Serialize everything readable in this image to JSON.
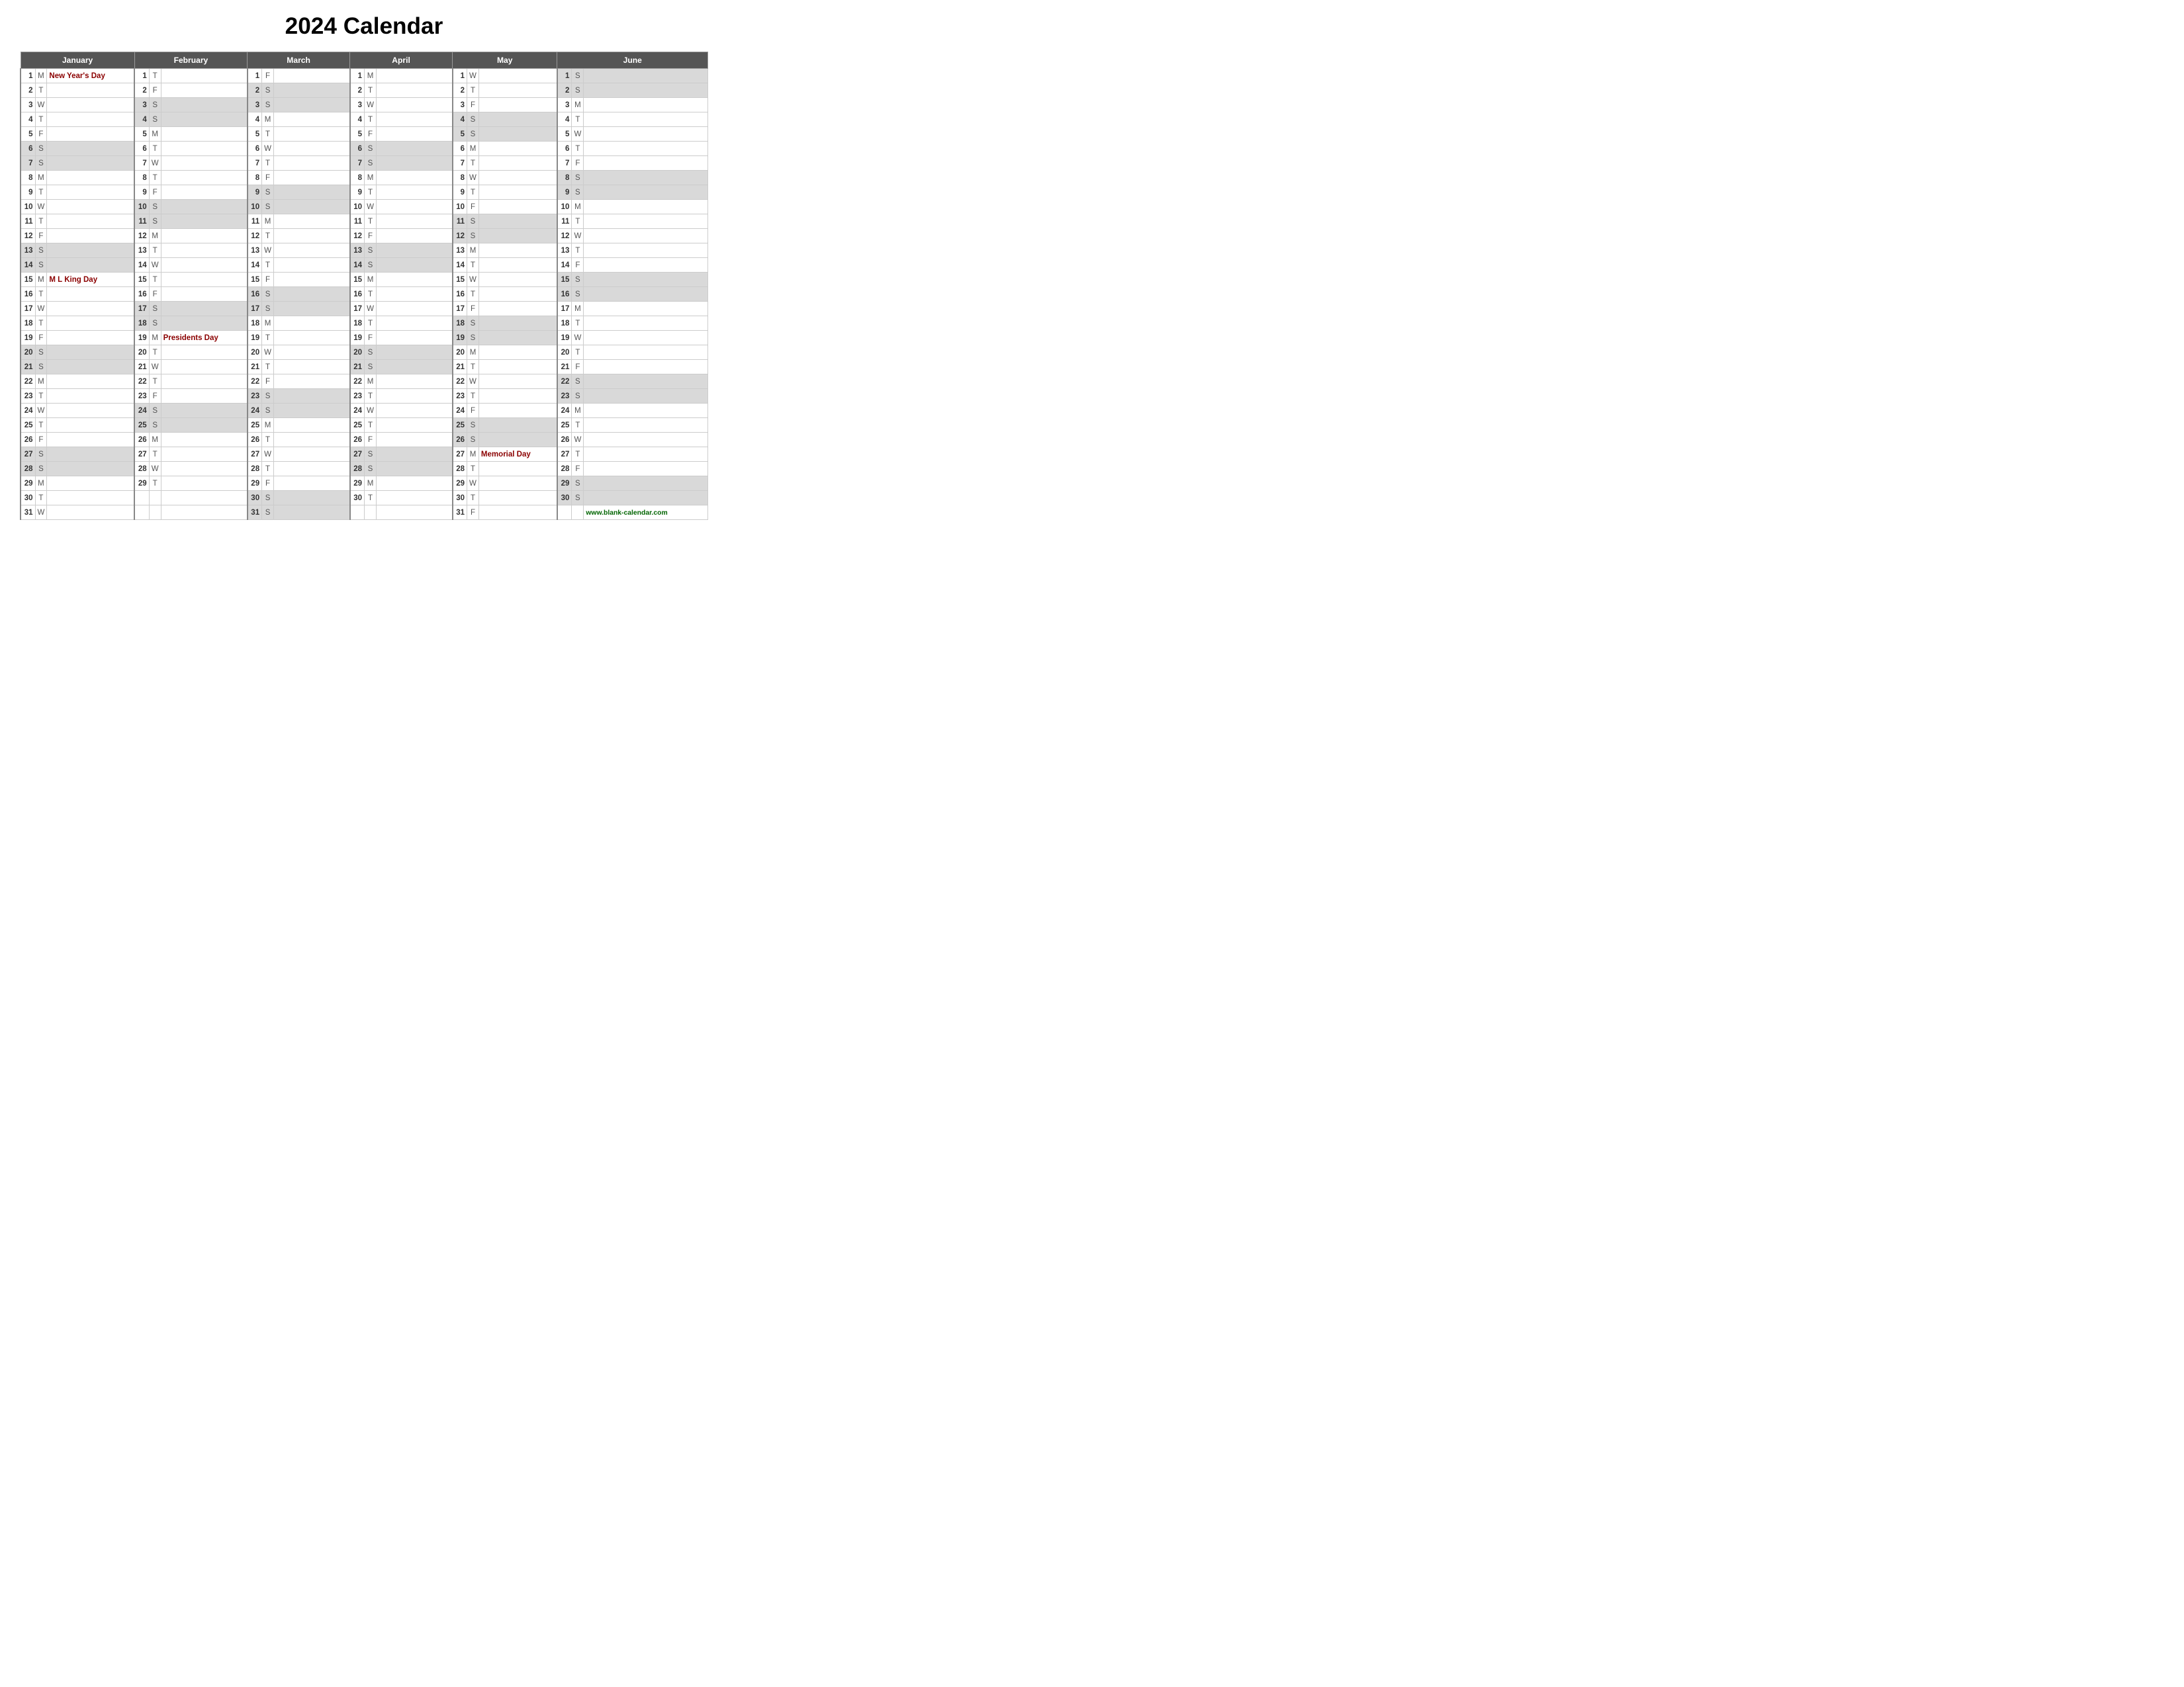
{
  "title": "2024 Calendar",
  "months": [
    "January",
    "February",
    "March",
    "April",
    "May",
    "June"
  ],
  "website": "www.blank-calendar.com",
  "holidays": {
    "jan_1": "New Year's Day",
    "jan_15": "M L King Day",
    "feb_19": "Presidents Day",
    "may_27": "Memorial Day"
  },
  "rows": [
    {
      "jan": {
        "d": 1,
        "l": "M",
        "h": "New Year's Day"
      },
      "feb": {
        "d": 1,
        "l": "T",
        "h": ""
      },
      "mar": {
        "d": 1,
        "l": "F",
        "h": ""
      },
      "apr": {
        "d": 1,
        "l": "M",
        "h": ""
      },
      "may": {
        "d": 1,
        "l": "W",
        "h": ""
      },
      "jun": {
        "d": 1,
        "l": "S",
        "h": "",
        "shade": true
      }
    },
    {
      "jan": {
        "d": 2,
        "l": "T",
        "h": ""
      },
      "feb": {
        "d": 2,
        "l": "F",
        "h": ""
      },
      "mar": {
        "d": 2,
        "l": "S",
        "h": "",
        "shade": true
      },
      "apr": {
        "d": 2,
        "l": "T",
        "h": ""
      },
      "may": {
        "d": 2,
        "l": "T",
        "h": ""
      },
      "jun": {
        "d": 2,
        "l": "S",
        "h": "",
        "shade": true
      }
    },
    {
      "jan": {
        "d": 3,
        "l": "W",
        "h": ""
      },
      "feb": {
        "d": 3,
        "l": "S",
        "h": "",
        "shade": true
      },
      "mar": {
        "d": 3,
        "l": "S",
        "h": "",
        "shade": true
      },
      "apr": {
        "d": 3,
        "l": "W",
        "h": ""
      },
      "may": {
        "d": 3,
        "l": "F",
        "h": ""
      },
      "jun": {
        "d": 3,
        "l": "M",
        "h": ""
      }
    },
    {
      "jan": {
        "d": 4,
        "l": "T",
        "h": ""
      },
      "feb": {
        "d": 4,
        "l": "S",
        "h": "",
        "shade": true
      },
      "mar": {
        "d": 4,
        "l": "M",
        "h": ""
      },
      "apr": {
        "d": 4,
        "l": "T",
        "h": ""
      },
      "may": {
        "d": 4,
        "l": "S",
        "h": "",
        "shade": true
      },
      "jun": {
        "d": 4,
        "l": "T",
        "h": ""
      }
    },
    {
      "jan": {
        "d": 5,
        "l": "F",
        "h": ""
      },
      "feb": {
        "d": 5,
        "l": "M",
        "h": ""
      },
      "mar": {
        "d": 5,
        "l": "T",
        "h": ""
      },
      "apr": {
        "d": 5,
        "l": "F",
        "h": ""
      },
      "may": {
        "d": 5,
        "l": "S",
        "h": "",
        "shade": true
      },
      "jun": {
        "d": 5,
        "l": "W",
        "h": ""
      }
    },
    {
      "jan": {
        "d": 6,
        "l": "S",
        "h": "",
        "shade": true
      },
      "feb": {
        "d": 6,
        "l": "T",
        "h": ""
      },
      "mar": {
        "d": 6,
        "l": "W",
        "h": ""
      },
      "apr": {
        "d": 6,
        "l": "S",
        "h": "",
        "shade": true
      },
      "may": {
        "d": 6,
        "l": "M",
        "h": ""
      },
      "jun": {
        "d": 6,
        "l": "T",
        "h": ""
      }
    },
    {
      "jan": {
        "d": 7,
        "l": "S",
        "h": "",
        "shade": true
      },
      "feb": {
        "d": 7,
        "l": "W",
        "h": ""
      },
      "mar": {
        "d": 7,
        "l": "T",
        "h": ""
      },
      "apr": {
        "d": 7,
        "l": "S",
        "h": "",
        "shade": true
      },
      "may": {
        "d": 7,
        "l": "T",
        "h": ""
      },
      "jun": {
        "d": 7,
        "l": "F",
        "h": ""
      }
    },
    {
      "jan": {
        "d": 8,
        "l": "M",
        "h": ""
      },
      "feb": {
        "d": 8,
        "l": "T",
        "h": ""
      },
      "mar": {
        "d": 8,
        "l": "F",
        "h": ""
      },
      "apr": {
        "d": 8,
        "l": "M",
        "h": ""
      },
      "may": {
        "d": 8,
        "l": "W",
        "h": ""
      },
      "jun": {
        "d": 8,
        "l": "S",
        "h": "",
        "shade": true
      }
    },
    {
      "jan": {
        "d": 9,
        "l": "T",
        "h": ""
      },
      "feb": {
        "d": 9,
        "l": "F",
        "h": ""
      },
      "mar": {
        "d": 9,
        "l": "S",
        "h": "",
        "shade": true
      },
      "apr": {
        "d": 9,
        "l": "T",
        "h": ""
      },
      "may": {
        "d": 9,
        "l": "T",
        "h": ""
      },
      "jun": {
        "d": 9,
        "l": "S",
        "h": "",
        "shade": true
      }
    },
    {
      "jan": {
        "d": 10,
        "l": "W",
        "h": ""
      },
      "feb": {
        "d": 10,
        "l": "S",
        "h": "",
        "shade": true
      },
      "mar": {
        "d": 10,
        "l": "S",
        "h": "",
        "shade": true
      },
      "apr": {
        "d": 10,
        "l": "W",
        "h": ""
      },
      "may": {
        "d": 10,
        "l": "F",
        "h": ""
      },
      "jun": {
        "d": 10,
        "l": "M",
        "h": ""
      }
    },
    {
      "jan": {
        "d": 11,
        "l": "T",
        "h": ""
      },
      "feb": {
        "d": 11,
        "l": "S",
        "h": "",
        "shade": true
      },
      "mar": {
        "d": 11,
        "l": "M",
        "h": ""
      },
      "apr": {
        "d": 11,
        "l": "T",
        "h": ""
      },
      "may": {
        "d": 11,
        "l": "S",
        "h": "",
        "shade": true
      },
      "jun": {
        "d": 11,
        "l": "T",
        "h": ""
      }
    },
    {
      "jan": {
        "d": 12,
        "l": "F",
        "h": ""
      },
      "feb": {
        "d": 12,
        "l": "M",
        "h": ""
      },
      "mar": {
        "d": 12,
        "l": "T",
        "h": ""
      },
      "apr": {
        "d": 12,
        "l": "F",
        "h": ""
      },
      "may": {
        "d": 12,
        "l": "S",
        "h": "",
        "shade": true
      },
      "jun": {
        "d": 12,
        "l": "W",
        "h": ""
      }
    },
    {
      "jan": {
        "d": 13,
        "l": "S",
        "h": "",
        "shade": true
      },
      "feb": {
        "d": 13,
        "l": "T",
        "h": ""
      },
      "mar": {
        "d": 13,
        "l": "W",
        "h": ""
      },
      "apr": {
        "d": 13,
        "l": "S",
        "h": "",
        "shade": true
      },
      "may": {
        "d": 13,
        "l": "M",
        "h": ""
      },
      "jun": {
        "d": 13,
        "l": "T",
        "h": ""
      }
    },
    {
      "jan": {
        "d": 14,
        "l": "S",
        "h": "",
        "shade": true
      },
      "feb": {
        "d": 14,
        "l": "W",
        "h": ""
      },
      "mar": {
        "d": 14,
        "l": "T",
        "h": ""
      },
      "apr": {
        "d": 14,
        "l": "S",
        "h": "",
        "shade": true
      },
      "may": {
        "d": 14,
        "l": "T",
        "h": ""
      },
      "jun": {
        "d": 14,
        "l": "F",
        "h": ""
      }
    },
    {
      "jan": {
        "d": 15,
        "l": "M",
        "h": "M L King Day"
      },
      "feb": {
        "d": 15,
        "l": "T",
        "h": ""
      },
      "mar": {
        "d": 15,
        "l": "F",
        "h": ""
      },
      "apr": {
        "d": 15,
        "l": "M",
        "h": ""
      },
      "may": {
        "d": 15,
        "l": "W",
        "h": ""
      },
      "jun": {
        "d": 15,
        "l": "S",
        "h": "",
        "shade": true
      }
    },
    {
      "jan": {
        "d": 16,
        "l": "T",
        "h": ""
      },
      "feb": {
        "d": 16,
        "l": "F",
        "h": ""
      },
      "mar": {
        "d": 16,
        "l": "S",
        "h": "",
        "shade": true
      },
      "apr": {
        "d": 16,
        "l": "T",
        "h": ""
      },
      "may": {
        "d": 16,
        "l": "T",
        "h": ""
      },
      "jun": {
        "d": 16,
        "l": "S",
        "h": "",
        "shade": true
      }
    },
    {
      "jan": {
        "d": 17,
        "l": "W",
        "h": ""
      },
      "feb": {
        "d": 17,
        "l": "S",
        "h": "",
        "shade": true
      },
      "mar": {
        "d": 17,
        "l": "S",
        "h": "",
        "shade": true
      },
      "apr": {
        "d": 17,
        "l": "W",
        "h": ""
      },
      "may": {
        "d": 17,
        "l": "F",
        "h": ""
      },
      "jun": {
        "d": 17,
        "l": "M",
        "h": ""
      }
    },
    {
      "jan": {
        "d": 18,
        "l": "T",
        "h": ""
      },
      "feb": {
        "d": 18,
        "l": "S",
        "h": "",
        "shade": true
      },
      "mar": {
        "d": 18,
        "l": "M",
        "h": ""
      },
      "apr": {
        "d": 18,
        "l": "T",
        "h": ""
      },
      "may": {
        "d": 18,
        "l": "S",
        "h": "",
        "shade": true
      },
      "jun": {
        "d": 18,
        "l": "T",
        "h": ""
      }
    },
    {
      "jan": {
        "d": 19,
        "l": "F",
        "h": ""
      },
      "feb": {
        "d": 19,
        "l": "M",
        "h": "Presidents Day"
      },
      "mar": {
        "d": 19,
        "l": "T",
        "h": ""
      },
      "apr": {
        "d": 19,
        "l": "F",
        "h": ""
      },
      "may": {
        "d": 19,
        "l": "S",
        "h": "",
        "shade": true
      },
      "jun": {
        "d": 19,
        "l": "W",
        "h": ""
      }
    },
    {
      "jan": {
        "d": 20,
        "l": "S",
        "h": "",
        "shade": true
      },
      "feb": {
        "d": 20,
        "l": "T",
        "h": ""
      },
      "mar": {
        "d": 20,
        "l": "W",
        "h": ""
      },
      "apr": {
        "d": 20,
        "l": "S",
        "h": "",
        "shade": true
      },
      "may": {
        "d": 20,
        "l": "M",
        "h": ""
      },
      "jun": {
        "d": 20,
        "l": "T",
        "h": ""
      }
    },
    {
      "jan": {
        "d": 21,
        "l": "S",
        "h": "",
        "shade": true
      },
      "feb": {
        "d": 21,
        "l": "W",
        "h": ""
      },
      "mar": {
        "d": 21,
        "l": "T",
        "h": ""
      },
      "apr": {
        "d": 21,
        "l": "S",
        "h": "",
        "shade": true
      },
      "may": {
        "d": 21,
        "l": "T",
        "h": ""
      },
      "jun": {
        "d": 21,
        "l": "F",
        "h": ""
      }
    },
    {
      "jan": {
        "d": 22,
        "l": "M",
        "h": ""
      },
      "feb": {
        "d": 22,
        "l": "T",
        "h": ""
      },
      "mar": {
        "d": 22,
        "l": "F",
        "h": ""
      },
      "apr": {
        "d": 22,
        "l": "M",
        "h": ""
      },
      "may": {
        "d": 22,
        "l": "W",
        "h": ""
      },
      "jun": {
        "d": 22,
        "l": "S",
        "h": "",
        "shade": true
      }
    },
    {
      "jan": {
        "d": 23,
        "l": "T",
        "h": ""
      },
      "feb": {
        "d": 23,
        "l": "F",
        "h": ""
      },
      "mar": {
        "d": 23,
        "l": "S",
        "h": "",
        "shade": true
      },
      "apr": {
        "d": 23,
        "l": "T",
        "h": ""
      },
      "may": {
        "d": 23,
        "l": "T",
        "h": ""
      },
      "jun": {
        "d": 23,
        "l": "S",
        "h": "",
        "shade": true
      }
    },
    {
      "jan": {
        "d": 24,
        "l": "W",
        "h": ""
      },
      "feb": {
        "d": 24,
        "l": "S",
        "h": "",
        "shade": true
      },
      "mar": {
        "d": 24,
        "l": "S",
        "h": "",
        "shade": true
      },
      "apr": {
        "d": 24,
        "l": "W",
        "h": ""
      },
      "may": {
        "d": 24,
        "l": "F",
        "h": ""
      },
      "jun": {
        "d": 24,
        "l": "M",
        "h": ""
      }
    },
    {
      "jan": {
        "d": 25,
        "l": "T",
        "h": ""
      },
      "feb": {
        "d": 25,
        "l": "S",
        "h": "",
        "shade": true
      },
      "mar": {
        "d": 25,
        "l": "M",
        "h": ""
      },
      "apr": {
        "d": 25,
        "l": "T",
        "h": ""
      },
      "may": {
        "d": 25,
        "l": "S",
        "h": "",
        "shade": true
      },
      "jun": {
        "d": 25,
        "l": "T",
        "h": ""
      }
    },
    {
      "jan": {
        "d": 26,
        "l": "F",
        "h": ""
      },
      "feb": {
        "d": 26,
        "l": "M",
        "h": ""
      },
      "mar": {
        "d": 26,
        "l": "T",
        "h": ""
      },
      "apr": {
        "d": 26,
        "l": "F",
        "h": ""
      },
      "may": {
        "d": 26,
        "l": "S",
        "h": "",
        "shade": true
      },
      "jun": {
        "d": 26,
        "l": "W",
        "h": ""
      }
    },
    {
      "jan": {
        "d": 27,
        "l": "S",
        "h": "",
        "shade": true
      },
      "feb": {
        "d": 27,
        "l": "T",
        "h": ""
      },
      "mar": {
        "d": 27,
        "l": "W",
        "h": ""
      },
      "apr": {
        "d": 27,
        "l": "S",
        "h": "",
        "shade": true
      },
      "may": {
        "d": 27,
        "l": "M",
        "h": "Memorial Day"
      },
      "jun": {
        "d": 27,
        "l": "T",
        "h": ""
      }
    },
    {
      "jan": {
        "d": 28,
        "l": "S",
        "h": "",
        "shade": true
      },
      "feb": {
        "d": 28,
        "l": "W",
        "h": ""
      },
      "mar": {
        "d": 28,
        "l": "T",
        "h": ""
      },
      "apr": {
        "d": 28,
        "l": "S",
        "h": "",
        "shade": true
      },
      "may": {
        "d": 28,
        "l": "T",
        "h": ""
      },
      "jun": {
        "d": 28,
        "l": "F",
        "h": ""
      }
    },
    {
      "jan": {
        "d": 29,
        "l": "M",
        "h": ""
      },
      "feb": {
        "d": 29,
        "l": "T",
        "h": ""
      },
      "mar": {
        "d": 29,
        "l": "F",
        "h": ""
      },
      "apr": {
        "d": 29,
        "l": "M",
        "h": ""
      },
      "may": {
        "d": 29,
        "l": "W",
        "h": ""
      },
      "jun": {
        "d": 29,
        "l": "S",
        "h": "",
        "shade": true
      }
    },
    {
      "jan": {
        "d": 30,
        "l": "T",
        "h": ""
      },
      "feb": null,
      "mar": {
        "d": 30,
        "l": "S",
        "h": "",
        "shade": true
      },
      "apr": {
        "d": 30,
        "l": "T",
        "h": ""
      },
      "may": {
        "d": 30,
        "l": "T",
        "h": ""
      },
      "jun": {
        "d": 30,
        "l": "S",
        "h": "",
        "shade": true
      }
    },
    {
      "jan": {
        "d": 31,
        "l": "W",
        "h": ""
      },
      "feb": null,
      "mar": {
        "d": 31,
        "l": "S",
        "h": "",
        "shade": true
      },
      "apr": null,
      "may": {
        "d": 31,
        "l": "F",
        "h": ""
      },
      "jun": null
    }
  ]
}
